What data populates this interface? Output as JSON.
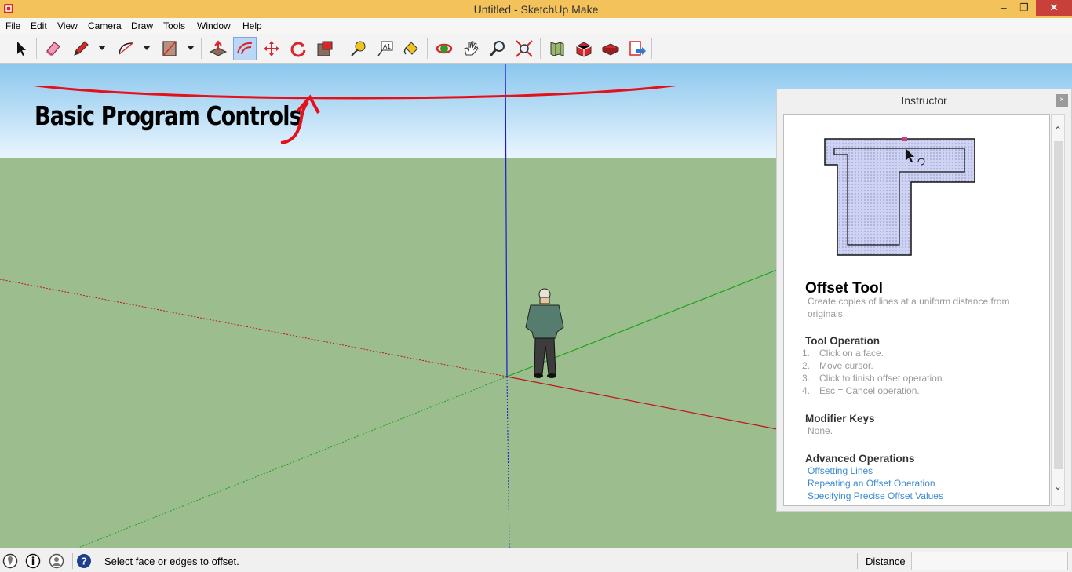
{
  "window": {
    "title": "Untitled - SketchUp Make",
    "minimize": "‒",
    "maximize": "❐",
    "close": "✕"
  },
  "menu": [
    "File",
    "Edit",
    "View",
    "Camera",
    "Draw",
    "Tools",
    "Window",
    "Help"
  ],
  "toolbar": {
    "tools": [
      {
        "name": "select-tool",
        "icon": "arrow-icon"
      },
      {
        "name": "eraser-tool",
        "icon": "eraser-icon"
      },
      {
        "name": "line-tool",
        "icon": "pencil-icon"
      },
      {
        "name": "arc-tool",
        "icon": "arc-icon"
      },
      {
        "name": "rectangle-tool",
        "icon": "rectangle-icon"
      },
      {
        "name": "push-pull-tool",
        "icon": "push-pull-icon"
      },
      {
        "name": "offset-tool",
        "icon": "offset-icon",
        "active": true
      },
      {
        "name": "move-tool",
        "icon": "move-icon"
      },
      {
        "name": "rotate-tool",
        "icon": "rotate-icon"
      },
      {
        "name": "scale-tool",
        "icon": "scale-icon"
      },
      {
        "name": "tape-measure-tool",
        "icon": "tape-measure-icon"
      },
      {
        "name": "text-tool",
        "icon": "text-icon"
      },
      {
        "name": "paint-bucket-tool",
        "icon": "paint-bucket-icon"
      },
      {
        "name": "orbit-tool",
        "icon": "orbit-icon"
      },
      {
        "name": "pan-tool",
        "icon": "hand-icon"
      },
      {
        "name": "zoom-tool",
        "icon": "magnifier-icon"
      },
      {
        "name": "zoom-extents-tool",
        "icon": "zoom-extents-icon"
      },
      {
        "name": "add-location-tool",
        "icon": "map-icon"
      },
      {
        "name": "3d-warehouse-tool",
        "icon": "warehouse-icon"
      },
      {
        "name": "extension-warehouse-tool",
        "icon": "extension-icon"
      },
      {
        "name": "send-to-layout-tool",
        "icon": "layout-icon"
      }
    ],
    "text_tool_glyph": "A1"
  },
  "annotation": {
    "text": "Basic Program Controls",
    "color": "#e5101a"
  },
  "instructor": {
    "title": "Instructor",
    "close": "×",
    "tool_title": "Offset Tool",
    "description": "Create copies of lines at a uniform distance from originals.",
    "operation_heading": "Tool Operation",
    "steps": [
      {
        "num": "1.",
        "text": "Click on a face."
      },
      {
        "num": "2.",
        "text": "Move cursor."
      },
      {
        "num": "3.",
        "text": "Click to finish offset operation."
      },
      {
        "num": "4.",
        "text": "Esc = Cancel operation."
      }
    ],
    "modifier_heading": "Modifier Keys",
    "modifier_text": "None.",
    "advanced_heading": "Advanced Operations",
    "links": [
      "Offsetting Lines",
      "Repeating an Offset Operation",
      "Specifying Precise Offset Values"
    ],
    "scroll_up": "⌃",
    "scroll_down": "⌄"
  },
  "status": {
    "message": "Select face or edges to offset.",
    "measurement_label": "Distance",
    "measurement_value": ""
  },
  "colors": {
    "title_bar": "#f4c25a",
    "sky": "#8cc7ee",
    "ground": "#9cbe8e",
    "red_axis": "#c0141a",
    "green_axis": "#1aa21a",
    "blue_axis": "#1a1ad0",
    "link": "#3b8ad0"
  }
}
